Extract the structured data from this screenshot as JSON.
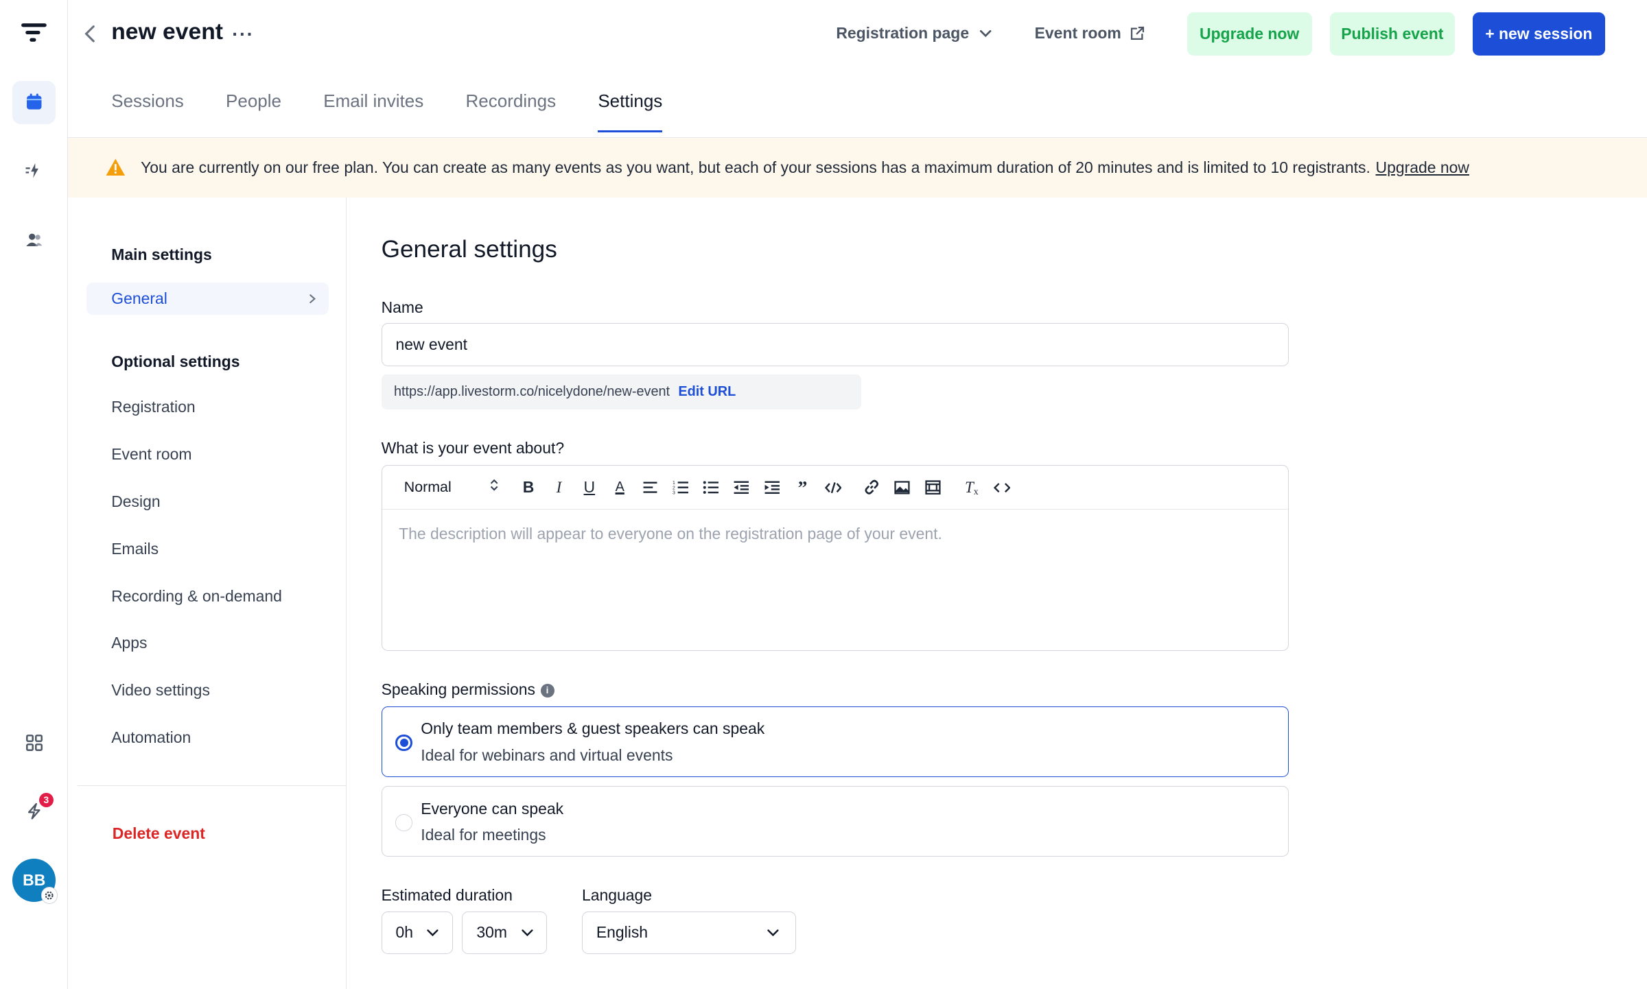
{
  "header": {
    "title": "new event",
    "more_label": "···",
    "registration_page": "Registration page",
    "event_room": "Event room",
    "upgrade_now": "Upgrade now",
    "publish_event": "Publish event",
    "new_session": "+ new session"
  },
  "tabs": [
    {
      "label": "Sessions"
    },
    {
      "label": "People"
    },
    {
      "label": "Email invites"
    },
    {
      "label": "Recordings"
    },
    {
      "label": "Settings"
    }
  ],
  "active_tab": "Settings",
  "banner": {
    "text": "You are currently on our free plan. You can create as many events as you want, but each of your sessions has a maximum duration of 20 minutes and is limited to 10 registrants.",
    "link": "Upgrade now"
  },
  "sidebar": {
    "main_heading": "Main settings",
    "general": "General",
    "optional_heading": "Optional settings",
    "items": [
      {
        "label": "Registration"
      },
      {
        "label": "Event room"
      },
      {
        "label": "Design"
      },
      {
        "label": "Emails"
      },
      {
        "label": "Recording & on-demand"
      },
      {
        "label": "Apps"
      },
      {
        "label": "Video settings"
      },
      {
        "label": "Automation"
      }
    ],
    "delete": "Delete event"
  },
  "rail": {
    "notification_count": "3",
    "avatar_initials": "BB"
  },
  "main": {
    "heading": "General settings",
    "name_label": "Name",
    "name_value": "new event",
    "url": "https://app.livestorm.co/nicelydone/new-event",
    "edit_url": "Edit URL",
    "about_label": "What is your event about?",
    "format": "Normal",
    "description_placeholder": "The description will appear to everyone on the registration page of your event.",
    "speaking_label": "Speaking permissions",
    "options": [
      {
        "title": "Only team members & guest speakers can speak",
        "subtitle": "Ideal for webinars and virtual events",
        "selected": true
      },
      {
        "title": "Everyone can speak",
        "subtitle": "Ideal for meetings",
        "selected": false
      }
    ],
    "duration_label": "Estimated duration",
    "hours": "0h",
    "minutes": "30m",
    "language_label": "Language",
    "language": "English"
  },
  "colors": {
    "accent": "#1d4ed8",
    "success_bg": "#dcfce7",
    "success_text": "#16a34a",
    "danger": "#dc2626",
    "banner_bg": "#fef7ec"
  }
}
